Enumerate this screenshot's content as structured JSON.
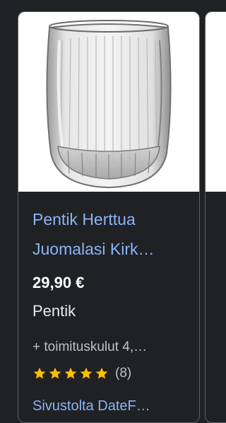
{
  "product": {
    "title_line1": "Pentik Herttua",
    "title_line2": "Juomalasi Kirk…",
    "price": "29,90 €",
    "merchant": "Pentik",
    "shipping": "+ toimituskulut 4,…",
    "rating_value": 5,
    "rating_count": "(8)",
    "source": "Sivustolta DateF…",
    "image_icon": "drinking-glass"
  },
  "colors": {
    "background": "#202124",
    "link": "#8ab4f8",
    "star": "#fbbc04",
    "card_border": "#5f6368"
  }
}
